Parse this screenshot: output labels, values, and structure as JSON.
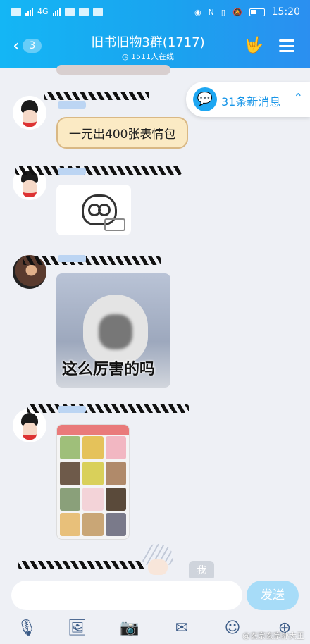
{
  "status": {
    "time": "15:20",
    "left_label": "4G"
  },
  "header": {
    "back_count": "3",
    "title": "旧书旧物3群(1717)",
    "online": "1511人在线"
  },
  "chat": {
    "new_messages": "31条新消息",
    "messages": [
      {
        "text": "一元出400张表情包"
      },
      {
        "caption": "这么厉害的吗"
      }
    ],
    "self_label": "我"
  },
  "input": {
    "placeholder": "",
    "send_label": "发送"
  },
  "watermark": "@玄宗玄宗孙大王"
}
